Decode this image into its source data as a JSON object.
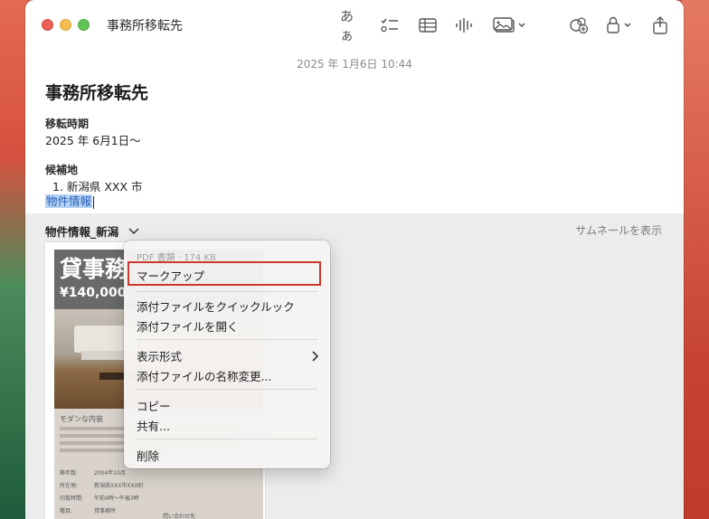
{
  "window": {
    "title": "事務所移転先",
    "toolbar": {
      "format_label": "あぁ",
      "icons": [
        "checklist-icon",
        "table-icon",
        "audio-waveform-icon",
        "media-icon",
        "collaborate-icon",
        "lock-icon",
        "share-icon"
      ]
    }
  },
  "note": {
    "date": "2025 年 1月6日 10:44",
    "title": "事務所移転先",
    "section1_label": "移転時期",
    "section1_value": "2025 年 6月1日〜",
    "section2_label": "候補地",
    "list_item": "1. 新潟県 XXX 市",
    "selected_text": "物件情報"
  },
  "attachment": {
    "name": "物件情報_新潟",
    "thumbnail_button": "サムネールを表示",
    "pdf": {
      "title": "貸事務",
      "price": "¥140,000/",
      "subtitle": "モダンな内装",
      "rows": [
        "築年数:",
        "所在地:",
        "内覧時間:",
        "種目:"
      ],
      "row_values": [
        "2004年10月",
        "新潟県XXX市XXX町",
        "午前9時〜午後3時",
        "貸事務所"
      ],
      "contact": "問い合わせ先"
    }
  },
  "context_menu": {
    "header": "PDF 書類 · 174 KB",
    "items": {
      "markup": "マークアップ",
      "quicklook": "添付ファイルをクイックルック",
      "open": "添付ファイルを開く",
      "view_as": "表示形式",
      "rename": "添付ファイルの名称変更...",
      "copy": "コピー",
      "share": "共有...",
      "delete": "削除"
    }
  }
}
